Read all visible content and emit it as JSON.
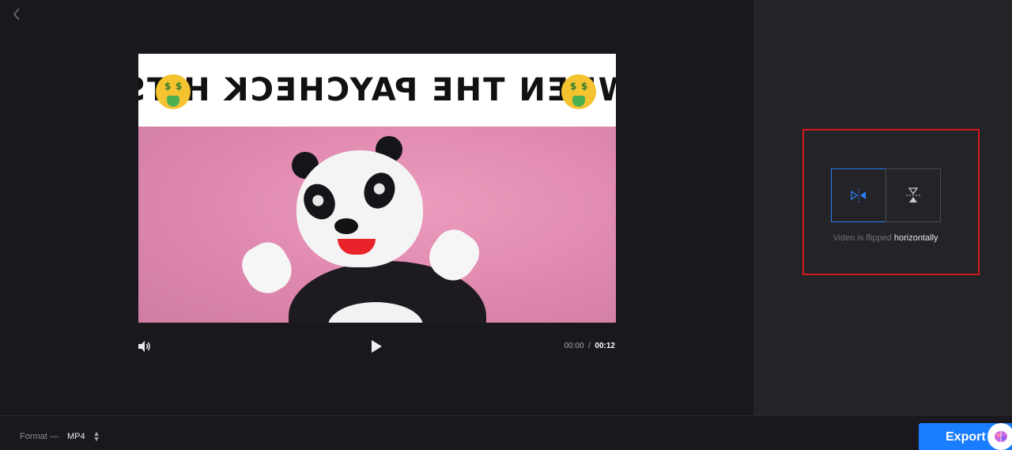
{
  "nav": {
    "back_icon": "chevron-left-icon"
  },
  "video": {
    "caption": "WHEN THE PAYCHECK HITS",
    "emoji_icon": "money-mouth-face-icon",
    "emoji_eye_glyph": "$"
  },
  "player": {
    "volume_icon": "speaker-icon",
    "play_icon": "play-icon",
    "current_time": "00:00",
    "separator": "/",
    "duration": "00:12"
  },
  "flip": {
    "horizontal_icon": "flip-horizontal-icon",
    "vertical_icon": "flip-vertical-icon",
    "active_option": "horizontal",
    "status_prefix": "Video is flipped",
    "status_mode": "horizontally",
    "highlight_color": "#d3181c",
    "active_color": "#2d7bf2"
  },
  "footer": {
    "format_label": "Format —",
    "format_value": "MP4",
    "export_label": "Export",
    "assistant_icon": "brain-icon",
    "export_color": "#1a7dff"
  }
}
